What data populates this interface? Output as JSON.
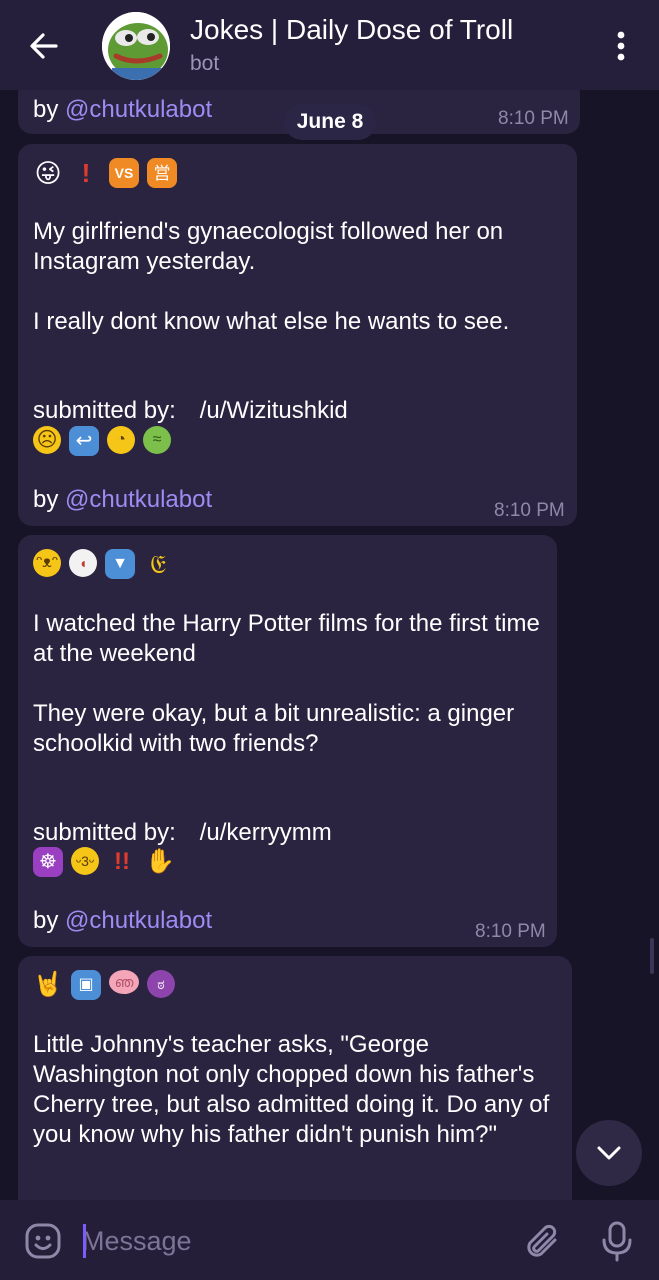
{
  "header": {
    "title": "Jokes | Daily Dose of Troll",
    "subtitle": "bot"
  },
  "date_pill": "June 8",
  "messages": [
    {
      "by_prefix": "by ",
      "by_link": "@chutkulabot",
      "time": "8:10 PM"
    },
    {
      "top_emojis": [
        {
          "icon": "zany-face-icon",
          "glyph": "😜",
          "bg": "transparent"
        },
        {
          "icon": "exclamation-icon",
          "glyph": "❗",
          "bg": "transparent"
        },
        {
          "icon": "vs-button-icon",
          "glyph": "VS",
          "bg": "#f08a24"
        },
        {
          "icon": "japanese-open-for-business-icon",
          "glyph": "営",
          "bg": "#f08a24"
        }
      ],
      "body": "My girlfriend's gynaecologist followed her on Instagram yesterday.\n\nI really dont know what else he wants to see.",
      "submitted_label": "submitted by:",
      "submitted_user": "/u/Wizitushkid",
      "bottom_emojis": [
        {
          "icon": "frowning-face-icon",
          "glyph": "☹",
          "bg": "transparent"
        },
        {
          "icon": "right-arrow-curving-left-icon",
          "glyph": "↪",
          "bg": "#4d8fd6"
        },
        {
          "icon": "face-with-monocle-icon",
          "glyph": "🧐",
          "bg": "transparent"
        },
        {
          "icon": "nauseated-face-icon",
          "glyph": "🤢",
          "bg": "transparent"
        }
      ],
      "by_prefix": "by ",
      "by_link": "@chutkulabot",
      "time": "8:10 PM"
    },
    {
      "top_emojis": [
        {
          "icon": "grinning-cat-icon",
          "glyph": "😸",
          "bg": "transparent"
        },
        {
          "icon": "baseball-icon",
          "glyph": "⚾",
          "bg": "transparent"
        },
        {
          "icon": "down-button-icon",
          "glyph": "🔽",
          "bg": "#4d8fd6"
        },
        {
          "icon": "ear-icon",
          "glyph": "👂",
          "bg": "transparent"
        }
      ],
      "body": "I watched the Harry Potter films for the first time at the weekend\n\nThey were okay, but a bit unrealistic: a ginger schoolkid with two friends?",
      "submitted_label": "submitted by:",
      "submitted_user": "/u/kerryymm",
      "bottom_emojis": [
        {
          "icon": "wheel-of-dharma-icon",
          "glyph": "☸",
          "bg": "#9b3fc2"
        },
        {
          "icon": "kissing-cat-icon",
          "glyph": "😽",
          "bg": "transparent"
        },
        {
          "icon": "double-exclamation-icon",
          "glyph": "‼",
          "bg": "transparent"
        },
        {
          "icon": "waving-hand-icon",
          "glyph": "👋",
          "bg": "transparent"
        }
      ],
      "by_prefix": "by ",
      "by_link": "@chutkulabot",
      "time": "8:10 PM"
    },
    {
      "top_emojis": [
        {
          "icon": "sign-of-horns-icon",
          "glyph": "🤘",
          "bg": "transparent"
        },
        {
          "icon": "passenger-ship-icon",
          "glyph": "🛂",
          "bg": "#4d8fd6"
        },
        {
          "icon": "brain-icon",
          "glyph": "🧠",
          "bg": "transparent"
        },
        {
          "icon": "angry-face-with-horns-icon",
          "glyph": "👿",
          "bg": "transparent"
        }
      ],
      "body": "Little Johnny's teacher asks, \"George Washington not only chopped down his father's Cherry tree, but also admitted doing it. Do any of you know why his father didn't punish him?\""
    }
  ],
  "input": {
    "placeholder": "Message",
    "value": ""
  },
  "colors": {
    "background": "#171427",
    "header": "#251f3b",
    "bubble": "#2a2440",
    "link": "#9d8cf2",
    "accent": "#7c5cff"
  }
}
